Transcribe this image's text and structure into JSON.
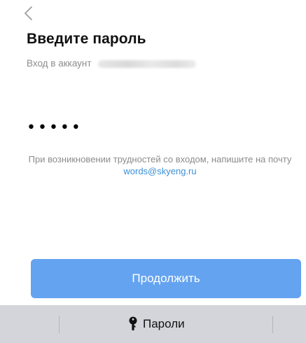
{
  "header": {
    "back_icon": "chevron-left-icon",
    "title": "Введите пароль",
    "subtitle": "Вход в аккаунт"
  },
  "password": {
    "value": "•••••"
  },
  "help": {
    "text": "При возникновении трудностей со входом, напишите на почту",
    "email": "words@skyeng.ru",
    "link_color": "#3b8fd6"
  },
  "actions": {
    "continue_label": "Продолжить",
    "button_color": "#64a3f0"
  },
  "keyboard_bar": {
    "key_icon": "key-icon",
    "passwords_label": "Пароли"
  }
}
